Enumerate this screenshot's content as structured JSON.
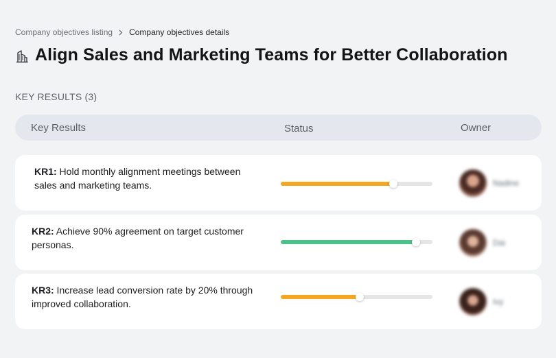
{
  "breadcrumb": {
    "parent": "Company objectives listing",
    "current": "Company objectives details"
  },
  "title": "Align Sales and Marketing Teams for Better Collaboration",
  "section_label": "KEY RESULTS (3)",
  "table": {
    "headers": {
      "key_results": "Key Results",
      "status": "Status",
      "owner": "Owner"
    },
    "rows": [
      {
        "code": "KR1:",
        "text": " Hold monthly alignment meetings between sales and marketing teams.",
        "progress": 0.74,
        "progress_color": "#f5a623",
        "owner_name": "Nadine"
      },
      {
        "code": "KR2:",
        "text": " Achieve 90% agreement on target customer personas.",
        "progress": 0.89,
        "progress_color": "#4ec089",
        "owner_name": "Dai"
      },
      {
        "code": "KR3:",
        "text": " Increase lead conversion rate by 20% through improved collaboration.",
        "progress": 0.52,
        "progress_color": "#f5a623",
        "owner_name": "Ivy"
      }
    ]
  },
  "icons": {
    "title_icon": "building-icon",
    "breadcrumb_separator": "chevron-right-icon"
  },
  "colors": {
    "background": "#f2f3f5",
    "header_bar": "#e4e8ee",
    "card": "#ffffff"
  }
}
